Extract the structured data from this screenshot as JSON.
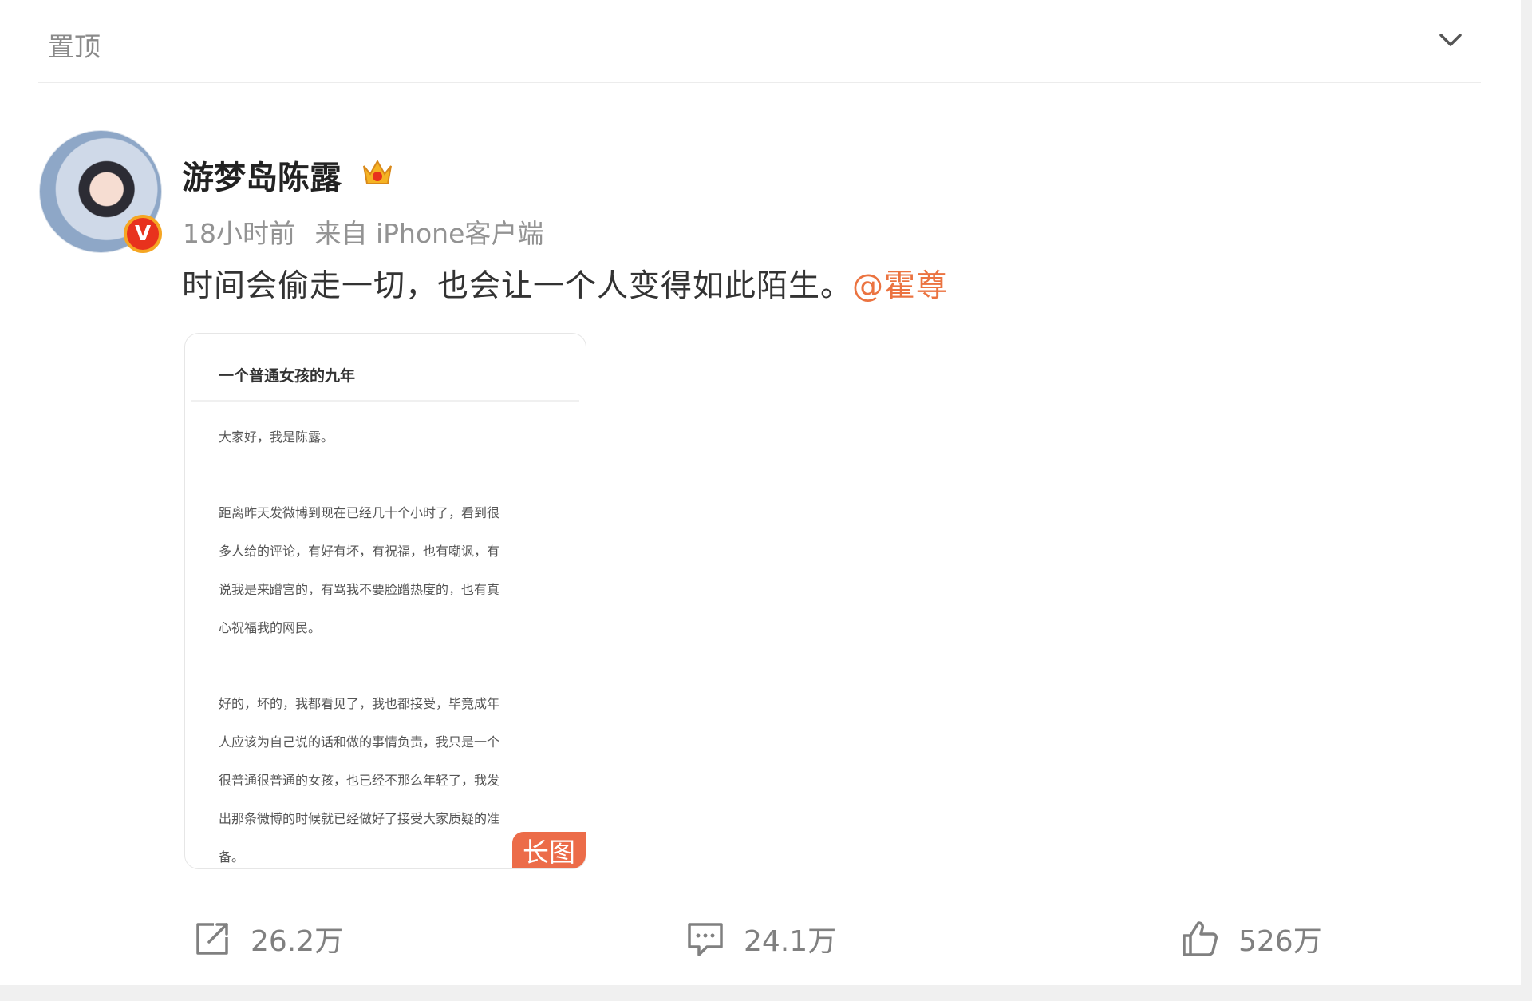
{
  "pin": {
    "label": "置顶"
  },
  "post": {
    "username": "游梦岛陈露",
    "time": "18小时前",
    "source": "来自 iPhone客户端",
    "text": "时间会偷走一切，也会让一个人变得如此陌生。",
    "mention": "@霍尊",
    "image": {
      "title": "一个普通女孩的九年",
      "lines": [
        "大家好，我是陈露。",
        "距离昨天发微博到现在已经几十个小时了，看到很",
        "多人给的评论，有好有坏，有祝福，也有嘲讽，有",
        "说我是来蹭宫的，有骂我不要脸蹭热度的，也有真",
        "心祝福我的网民。",
        "好的，坏的，我都看见了，我也都接受，毕竟成年",
        "人应该为自己说的话和做的事情负责，我只是一个",
        "很普通很普通的女孩，也已经不那么年轻了，我发",
        "出那条微博的时候就已经做好了接受大家质疑的准",
        "备。"
      ],
      "badge": "长图"
    }
  },
  "actions": {
    "repost": "26.2万",
    "comment": "24.1万",
    "like": "526万"
  },
  "colors": {
    "accent": "#eb7340",
    "badge": "#ec6c49",
    "verified": "#e8321d"
  },
  "icons": [
    "chevron-down-icon",
    "crown-icon",
    "verified-v-icon",
    "repost-icon",
    "comment-icon",
    "like-icon"
  ]
}
